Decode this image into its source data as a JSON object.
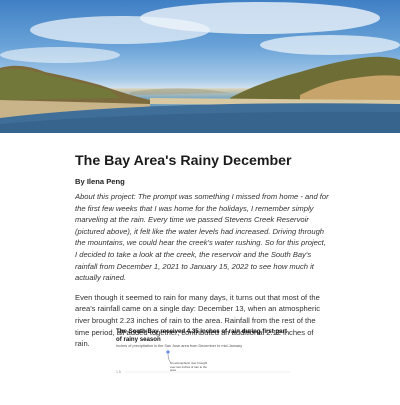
{
  "article": {
    "title": "The Bay Area's Rainy December",
    "byline": "By Ilena Peng",
    "intro": "About this project: The prompt was something I missed from home - and for the first few weeks that I was home for the holidays, I remember simply marveling at the rain. Every time we passed Stevens Creek Reservoir (pictured above), it felt like the water levels had increased. Driving through the mountains, we could hear the creek's water rushing. So for this project, I decided to take a look at the creek, the reservoir and the South Bay's rainfall from December 1, 2021 to January 15, 2022 to see how much it actually rained.",
    "paragraph1": "Even though it seemed to rain for many days, it turns out that most of the area's rainfall came on a single day: December 13, when an atmospheric river brought 2.23 inches of rain to the area. Rainfall from the rest of the time period, all added together, contributed an additional 2.12 inches of rain."
  },
  "figure": {
    "title": "The South Bay received 4.35 inches of rain during first part of rainy season",
    "subtitle": "Inches of precipitation in the San Jose area from December to mid-January",
    "annotation": "An atmospheric river brought over two inches of rain to the area",
    "y_tick": "1.5"
  },
  "colors": {
    "accent": "#5b8fd6",
    "annotation_dot": "#5b8fd6"
  }
}
